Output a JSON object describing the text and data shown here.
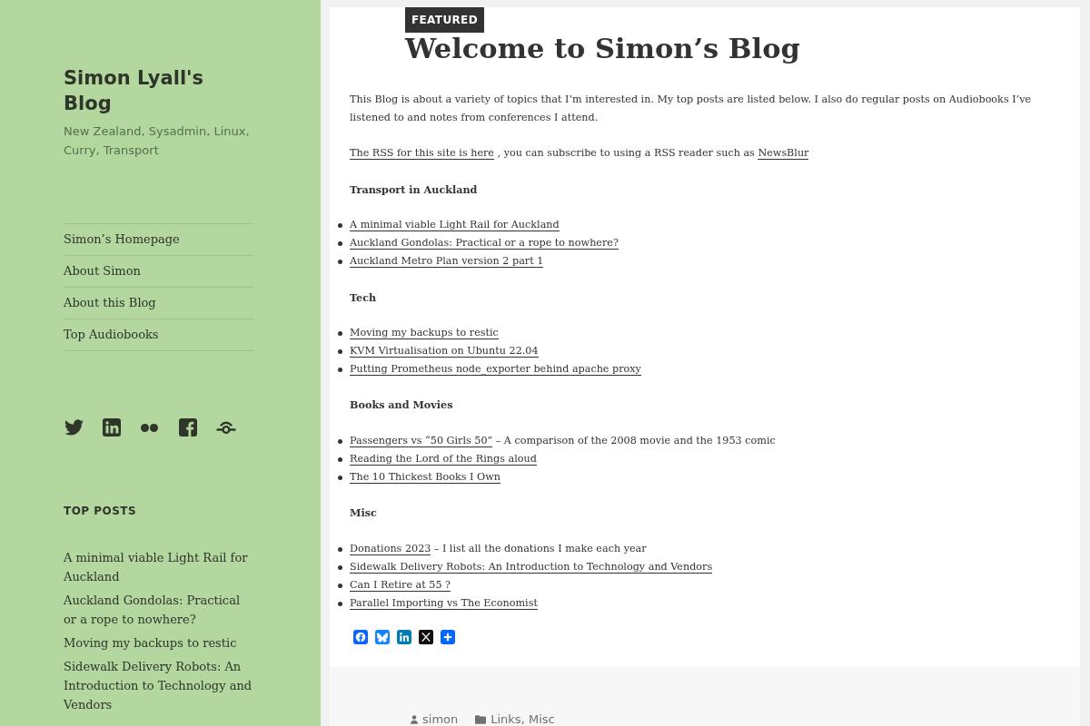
{
  "sidebar": {
    "site_title": "Simon Lyall's Blog",
    "tagline": "New Zealand, Sysadmin, Linux, Curry, Transport",
    "menu": [
      "Simon’s Homepage",
      "About Simon",
      "About this Blog",
      "Top Audiobooks"
    ],
    "top_posts": {
      "heading": "TOP POSTS",
      "items": [
        "A minimal viable Light Rail for Auckland",
        "Auckland Gondolas: Practical or a rope to nowhere?",
        "Moving my backups to restic",
        "Sidewalk Delivery Robots: An Introduction to Technology and Vendors"
      ]
    }
  },
  "post": {
    "badge": "FEATURED",
    "title": "Welcome to Simon’s Blog",
    "intro": "This Blog is about a variety of topics that I’m interested in. My top posts are listed below. I also do regular posts on Audiobooks I’ve listened to and notes from conferences I attend.",
    "rss_paragraph": [
      {
        "kind": "link",
        "text": "The RSS for this site is here"
      },
      {
        "kind": "text",
        "text": " , you can subscribe to using a RSS reader such as "
      },
      {
        "kind": "link",
        "text": "NewsBlur"
      }
    ],
    "sections": [
      {
        "heading": "Transport in Auckland",
        "items": [
          {
            "title": "A minimal viable Light Rail for Auckland"
          },
          {
            "title": "Auckland Gondolas: Practical or a rope to nowhere?"
          },
          {
            "title": "Auckland Metro Plan version 2 part 1"
          }
        ]
      },
      {
        "heading": "Tech",
        "items": [
          {
            "title": "Moving my backups to restic"
          },
          {
            "title": "KVM Virtualisation on Ubuntu 22.04"
          },
          {
            "title": "Putting Prometheus node_exporter behind apache proxy"
          }
        ]
      },
      {
        "heading": "Books and Movies",
        "items": [
          {
            "title": "Passengers vs “50 Girls 50”",
            "note": "– A comparison of the 2008 movie and the 1953 comic"
          },
          {
            "title": "Reading the Lord of the Rings aloud"
          },
          {
            "title": "The 10 Thickest Books I Own"
          }
        ]
      },
      {
        "heading": "Misc",
        "items": [
          {
            "title": "Donations 2023",
            "note": "– I list all the donations I make each year"
          },
          {
            "title": "Sidewalk Delivery Robots: An Introduction to Technology and Vendors"
          },
          {
            "title": "Can I Retire at 55 ?"
          },
          {
            "title": "Parallel Importing vs The Economist"
          }
        ]
      }
    ],
    "footer": {
      "author": "simon",
      "categories": "Links, Misc"
    }
  }
}
